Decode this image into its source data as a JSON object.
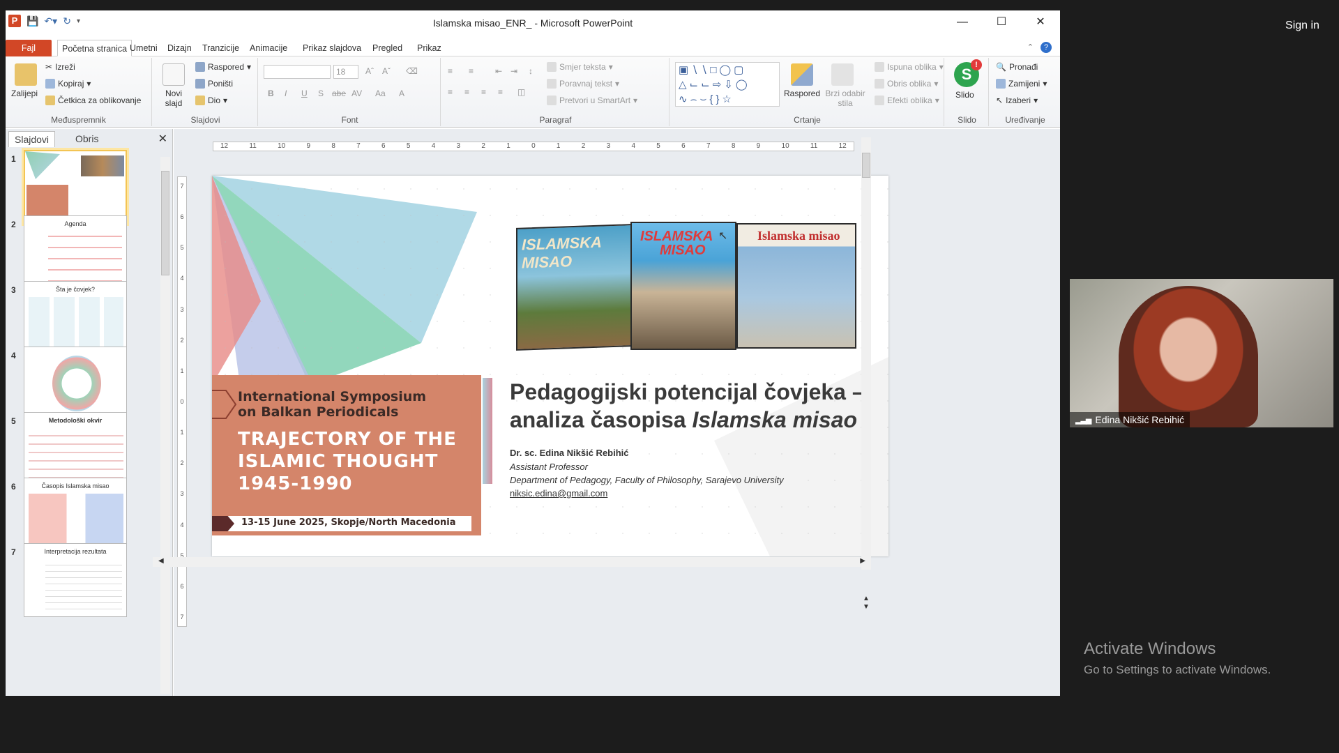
{
  "window": {
    "title": "Islamska misao_ENR_ - Microsoft PowerPoint",
    "app_icon": "P"
  },
  "meeting": {
    "sign_in": "Sign in",
    "participant_name": "Edina Nikšić Rebihić",
    "watermark_line1": "Activate Windows",
    "watermark_line2": "Go to Settings to activate Windows."
  },
  "tabs": [
    "Fajl",
    "Početna stranica",
    "Umetni",
    "Dizajn",
    "Tranzicije",
    "Animacije",
    "Prikaz slajdova",
    "Pregled",
    "Prikaz"
  ],
  "ribbon": {
    "clipboard": {
      "paste": "Zalijepi",
      "cut": "Izreži",
      "copy": "Kopiraj",
      "format_painter": "Četkica za oblikovanje",
      "label": "Međuspremnik"
    },
    "slides": {
      "new_slide": "Novi slajd",
      "layout": "Raspored",
      "reset": "Poništi",
      "section": "Dio",
      "label": "Slajdovi"
    },
    "font": {
      "size": "18",
      "label": "Font"
    },
    "paragraph": {
      "text_direction": "Smjer teksta",
      "align_text": "Poravnaj tekst",
      "smartart": "Pretvori u SmartArt",
      "label": "Paragraf"
    },
    "drawing": {
      "arrange": "Raspored",
      "quick_styles": "Brzi odabir stila",
      "fill": "Ispuna oblika",
      "outline": "Obris oblika",
      "effects": "Efekti oblika",
      "label": "Crtanje"
    },
    "slido": {
      "button": "Slido",
      "label": "Slido"
    },
    "editing": {
      "find": "Pronađi",
      "replace": "Zamijeni",
      "select": "Izaberi",
      "label": "Uređivanje"
    }
  },
  "panel": {
    "tab_slides": "Slajdovi",
    "tab_outline": "Obris",
    "thumbnails": [
      {
        "num": "1",
        "title": ""
      },
      {
        "num": "2",
        "title": "Agenda"
      },
      {
        "num": "3",
        "title": "Šta je čovjek?"
      },
      {
        "num": "4",
        "title": ""
      },
      {
        "num": "5",
        "title": "Metodološki okvir"
      },
      {
        "num": "6",
        "title": "Časopis Islamska misao"
      },
      {
        "num": "7",
        "title": "Interpretacija rezultata"
      }
    ]
  },
  "ruler": {
    "h_ticks": [
      "12",
      "11",
      "10",
      "9",
      "8",
      "7",
      "6",
      "5",
      "4",
      "3",
      "2",
      "1",
      "0",
      "1",
      "2",
      "3",
      "4",
      "5",
      "6",
      "7",
      "8",
      "9",
      "10",
      "11",
      "12"
    ],
    "v_ticks": [
      "7",
      "6",
      "5",
      "4",
      "3",
      "2",
      "1",
      "0",
      "1",
      "2",
      "3",
      "4",
      "5",
      "6",
      "7"
    ]
  },
  "slide": {
    "symposium_line1": "International Symposium",
    "symposium_line2": "on Balkan Periodicals",
    "trajectory_line1": "TRAJECTORY OF THE",
    "trajectory_line2": "ISLAMIC THOUGHT",
    "trajectory_line3": "1945-1990",
    "date_place": "13-15 June 2025, Skopje/North Macedonia",
    "title_line1": "Pedagogijski potencijal čovjeka –",
    "title_line2_prefix": "analiza časopisa ",
    "title_line2_italic": "Islamska misao",
    "author_name": "Dr. sc. Edina  Nikšić  Rebihić",
    "author_position": "Assistant Professor",
    "author_department": "Department  of Pedagogy,  Faculty of Philosophy, Sarajevo  University",
    "author_email": "niksic.edina@gmail.com",
    "magazine_left": "ISLAMSKA MISAO",
    "magazine_mid_1": "ISLAMSKA",
    "magazine_mid_2": "MISAO",
    "magazine_right": "Islamska misao"
  },
  "colors": {
    "accent_orange": "#d4856a",
    "office_red": "#d24726",
    "ribbon_bg": "#f0f2f5"
  }
}
